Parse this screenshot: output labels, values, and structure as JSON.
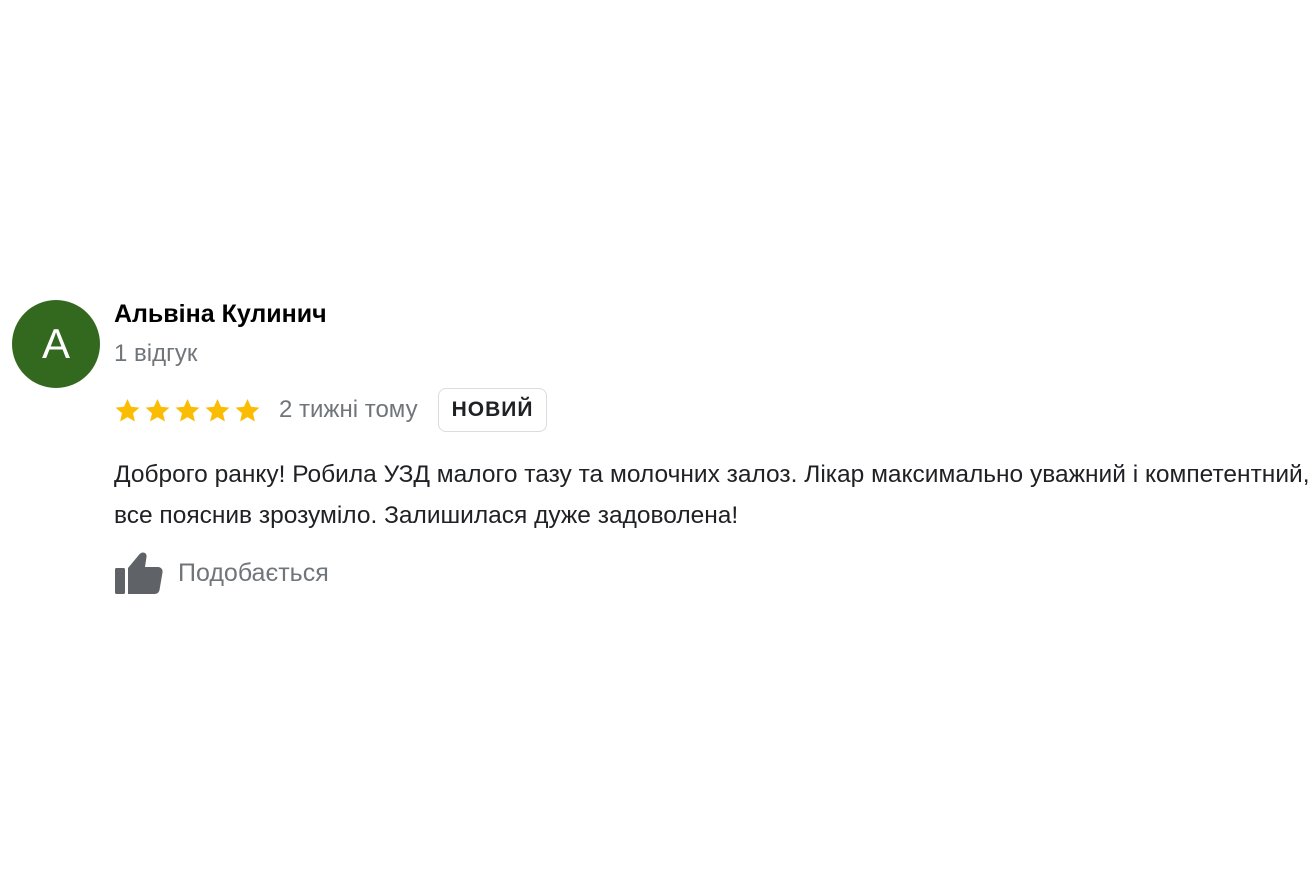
{
  "review": {
    "avatar_letter": "A",
    "avatar_color": "#33691e",
    "author": "Альвіна Кулинич",
    "review_count": "1 відгук",
    "rating": 5,
    "rating_max": 5,
    "star_color": "#fbbc04",
    "time": "2 тижні тому",
    "badge": "НОВИЙ",
    "text": "Доброго ранку! Робила УЗД малого тазу та молочних залоз. Лікар максимально уважний і компетентний, все пояснив зрозуміло. Залишилася дуже задоволена!",
    "like_icon": "thumbs-up-icon",
    "like_label": "Подобається"
  }
}
